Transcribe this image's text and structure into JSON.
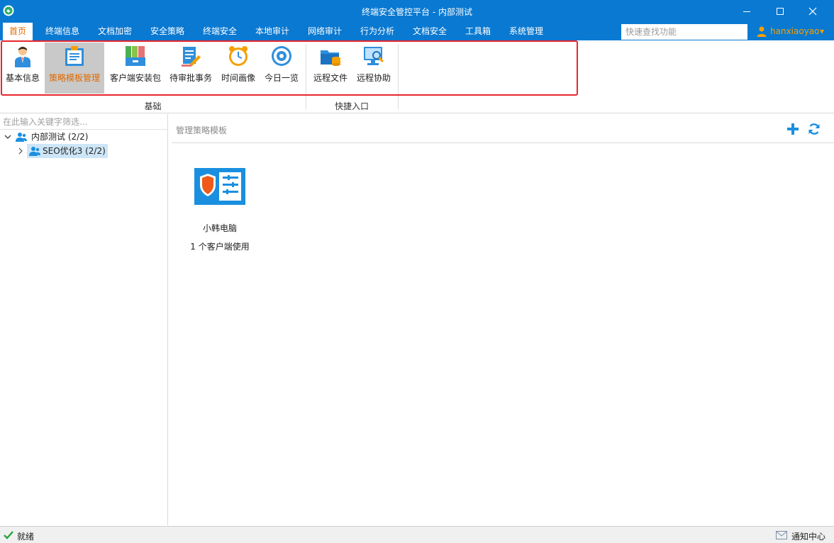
{
  "window": {
    "title": "终端安全管控平台 - 内部测试"
  },
  "menu": {
    "tabs": [
      {
        "label": "首页",
        "active": true
      },
      {
        "label": "终端信息"
      },
      {
        "label": "文档加密"
      },
      {
        "label": "安全策略"
      },
      {
        "label": "终端安全"
      },
      {
        "label": "本地审计"
      },
      {
        "label": "网络审计"
      },
      {
        "label": "行为分析"
      },
      {
        "label": "文档安全"
      },
      {
        "label": "工具箱"
      },
      {
        "label": "系统管理"
      }
    ],
    "search_placeholder": "快速查找功能",
    "user": "hanxiaoyao"
  },
  "ribbon": {
    "groups": [
      {
        "label": "基础",
        "items": [
          {
            "label": "基本信息",
            "icon": "person-icon"
          },
          {
            "label": "策略模板管理",
            "icon": "template-board-icon",
            "active": true
          },
          {
            "label": "客户端安装包",
            "icon": "package-folders-icon"
          },
          {
            "label": "待审批事务",
            "icon": "approval-document-icon"
          },
          {
            "label": "时间画像",
            "icon": "alarm-clock-icon"
          },
          {
            "label": "今日一览",
            "icon": "eye-icon"
          }
        ]
      },
      {
        "label": "快捷入口",
        "items": [
          {
            "label": "远程文件",
            "icon": "remote-folder-icon"
          },
          {
            "label": "远程协助",
            "icon": "remote-monitor-icon"
          }
        ]
      }
    ]
  },
  "tree": {
    "filter_placeholder": "在此输入关键字筛选...",
    "nodes": [
      {
        "label": "内部测试 (2/2)",
        "expanded": true
      },
      {
        "label": "SEO优化3 (2/2)",
        "selected": true
      }
    ]
  },
  "main": {
    "title": "管理策略模板",
    "templates": [
      {
        "name": "小韩电脑",
        "usage": "1 个客户端使用"
      }
    ]
  },
  "status": {
    "text": "就绪",
    "notify": "通知中心"
  },
  "colors": {
    "title_bar": "#0a79d1",
    "accent_orange": "#e06a00",
    "highlight_red": "#e8262c",
    "icon_blue": "#1a8fe0"
  }
}
